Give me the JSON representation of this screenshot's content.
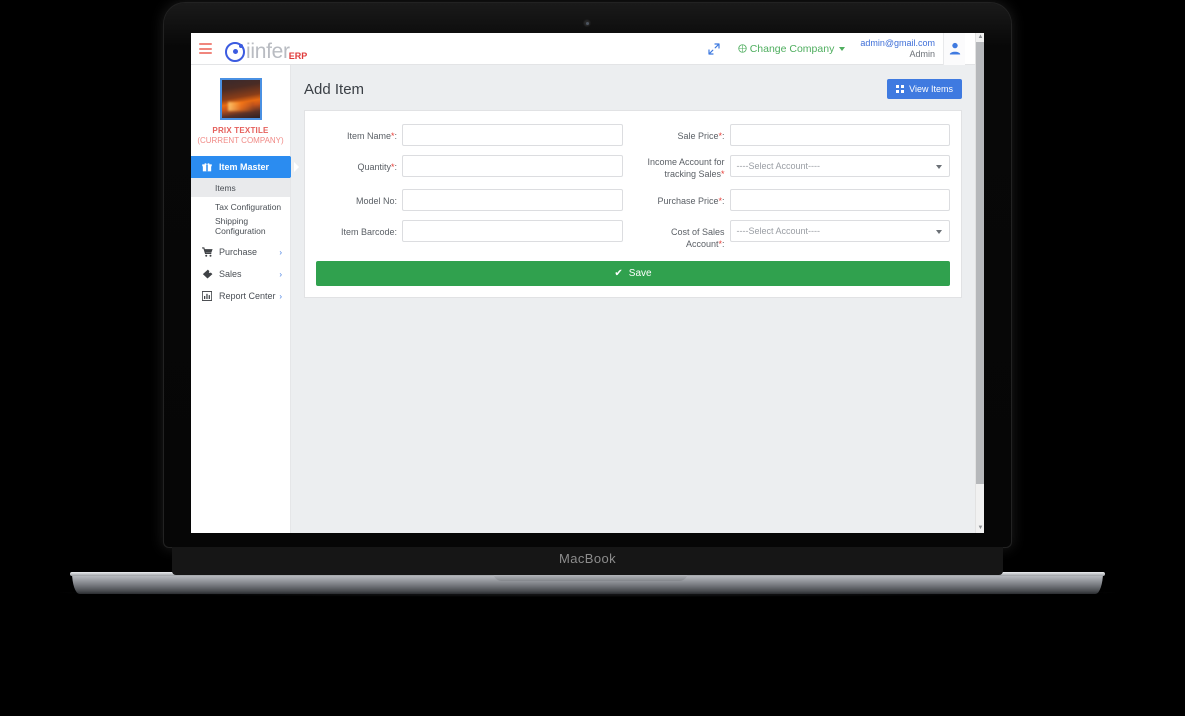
{
  "device": {
    "label": "MacBook"
  },
  "header": {
    "menu_icon": "hamburger-icon",
    "brand_name": "iinfer",
    "brand_suffix": "ERP",
    "expand_icon": "expand-arrows-icon",
    "change_company_label": "Change Company",
    "change_company_icon": "globe-icon",
    "account_email": "admin@gmail.com",
    "account_role": "Admin",
    "avatar_icon": "user-icon"
  },
  "sidebar": {
    "company_name": "PRIX TEXTILE",
    "company_current_label": "(CURRENT COMPANY)",
    "items": [
      {
        "label": "Item Master",
        "icon": "gift-icon",
        "active": true,
        "chevron": ""
      },
      {
        "label": "Purchase",
        "icon": "cart-icon",
        "active": false,
        "chevron": "›"
      },
      {
        "label": "Sales",
        "icon": "tag-icon",
        "active": false,
        "chevron": "›"
      },
      {
        "label": "Report Center",
        "icon": "bar-chart-icon",
        "active": false,
        "chevron": "›"
      }
    ],
    "subitems": [
      {
        "label": "Items",
        "selected": true
      },
      {
        "label": "Tax Configuration",
        "selected": false
      },
      {
        "label": "Shipping Configuration",
        "selected": false
      }
    ]
  },
  "main": {
    "page_title": "Add Item",
    "view_items_label": "View Items",
    "view_items_icon": "grid-icon",
    "fields": [
      {
        "label": "Item Name",
        "required": true,
        "type": "text",
        "value": "",
        "col": "left"
      },
      {
        "label": "Sale Price",
        "required": true,
        "type": "text",
        "value": "",
        "col": "right"
      },
      {
        "label": "Quantity",
        "required": true,
        "type": "text",
        "value": "",
        "col": "left"
      },
      {
        "label": "Income Account for tracking Sales",
        "required": true,
        "type": "select",
        "value": "----Select Account----",
        "col": "right"
      },
      {
        "label": "Model No",
        "required": false,
        "type": "text",
        "value": "",
        "col": "left"
      },
      {
        "label": "Purchase Price",
        "required": true,
        "type": "text",
        "value": "",
        "col": "right"
      },
      {
        "label": "Item Barcode",
        "required": false,
        "type": "text",
        "value": "",
        "col": "left"
      },
      {
        "label": "Cost of Sales Account",
        "required": true,
        "type": "select",
        "value": "----Select Account----",
        "col": "right"
      }
    ],
    "save_label": "Save",
    "save_icon": "check-icon"
  },
  "colors": {
    "accent_blue": "#3f7ae0",
    "active_nav_blue": "#2b8cf0",
    "save_green": "#30a14e",
    "required_red": "#e8403a",
    "company_red": "#e5605c"
  }
}
